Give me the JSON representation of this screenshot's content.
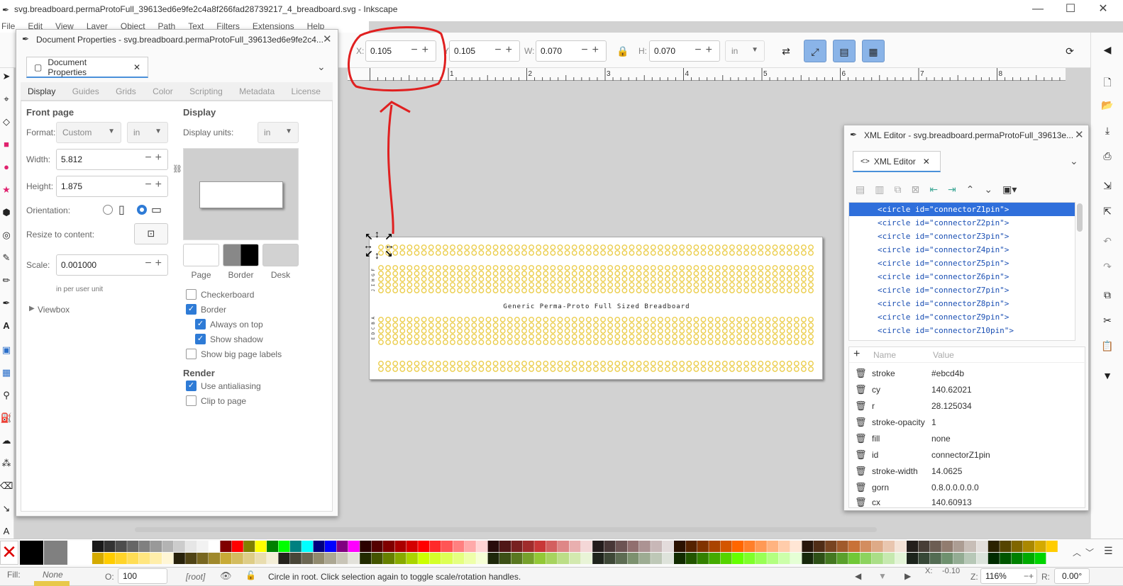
{
  "window": {
    "title": "svg.breadboard.permaProtoFull_39613ed6e9fe2c4a8f266fad28739217_4_breadboard.svg - Inkscape",
    "minimize": "—",
    "maximize": "☐",
    "close": "✕"
  },
  "menu": [
    "File",
    "Edit",
    "View",
    "Layer",
    "Object",
    "Path",
    "Text",
    "Filters",
    "Extensions",
    "Help"
  ],
  "toolbar": {
    "x_label": "X:",
    "x_value": "0.105",
    "y_label": "Y:",
    "y_value": "0.105",
    "w_label": "W:",
    "w_value": "0.070",
    "h_label": "H:",
    "h_value": "0.070",
    "unit": "in"
  },
  "ruler": {
    "ticks": [
      "1",
      "2",
      "3",
      "4",
      "5",
      "6",
      "7",
      "8"
    ]
  },
  "doc_props": {
    "title": "Document Properties - svg.breadboard.permaProtoFull_39613ed6e9fe2c4...",
    "tab_label": "Document Properties",
    "subtabs": [
      "Display",
      "Guides",
      "Grids",
      "Color",
      "Scripting",
      "Metadata",
      "License"
    ],
    "front_page": "Front page",
    "format_label": "Format:",
    "format_value": "Custom",
    "format_unit": "in",
    "width_label": "Width:",
    "width_value": "5.812",
    "height_label": "Height:",
    "height_value": "1.875",
    "orientation_label": "Orientation:",
    "resize_label": "Resize to content:",
    "scale_label": "Scale:",
    "scale_value": "0.001000",
    "scale_note": "in  per user unit",
    "viewbox": "Viewbox",
    "display_head": "Display",
    "display_units_label": "Display units:",
    "display_units_value": "in",
    "swatch_labels": [
      "Page",
      "Border",
      "Desk"
    ],
    "checkboxes": [
      {
        "label": "Checkerboard",
        "checked": false
      },
      {
        "label": "Border",
        "checked": true
      },
      {
        "label": "Always on top",
        "checked": true
      },
      {
        "label": "Show shadow",
        "checked": true
      },
      {
        "label": "Show big page labels",
        "checked": false
      }
    ],
    "render_head": "Render",
    "render_checkboxes": [
      {
        "label": "Use antialiasing",
        "checked": true
      },
      {
        "label": "Clip to page",
        "checked": false
      }
    ]
  },
  "breadboard": {
    "label": "Generic Perma-Proto Full Sized Breadboard",
    "row_letters_top": "J I H G F",
    "row_letters_bottom": "E D C B A"
  },
  "xml_editor": {
    "title": "XML Editor - svg.breadboard.permaProtoFull_39613e...",
    "tab_label": "XML Editor",
    "nodes": [
      "<circle id=\"connectorZ1pin\">",
      "<circle id=\"connectorZ2pin\">",
      "<circle id=\"connectorZ3pin\">",
      "<circle id=\"connectorZ4pin\">",
      "<circle id=\"connectorZ5pin\">",
      "<circle id=\"connectorZ6pin\">",
      "<circle id=\"connectorZ7pin\">",
      "<circle id=\"connectorZ8pin\">",
      "<circle id=\"connectorZ9pin\">",
      "<circle id=\"connectorZ10pin\">"
    ],
    "col_name": "Name",
    "col_value": "Value",
    "attrs": [
      {
        "name": "stroke",
        "value": "#ebcd4b"
      },
      {
        "name": "cy",
        "value": "140.62021"
      },
      {
        "name": "r",
        "value": "28.125034"
      },
      {
        "name": "stroke-opacity",
        "value": "1"
      },
      {
        "name": "fill",
        "value": "none"
      },
      {
        "name": "id",
        "value": "connectorZ1pin"
      },
      {
        "name": "stroke-width",
        "value": "14.0625"
      },
      {
        "name": "gorn",
        "value": "0.8.0.0.0.0.0"
      },
      {
        "name": "cx",
        "value": "140.60913"
      }
    ]
  },
  "status": {
    "fill_label": "Fill:",
    "fill_value": "None",
    "opacity_label": "O:",
    "opacity_value": "100",
    "layer": "[root]",
    "message": "Circle in root. Click selection again to toggle scale/rotation handles.",
    "x_label": "X:",
    "x_value": "-0.10",
    "z_label": "Z:",
    "zoom": "116%",
    "r_label": "R:",
    "rotation": "0.00°"
  },
  "colors": {
    "accent": "#2f6fdb",
    "annotation": "#e02020",
    "pin": "#ebcd4b"
  }
}
